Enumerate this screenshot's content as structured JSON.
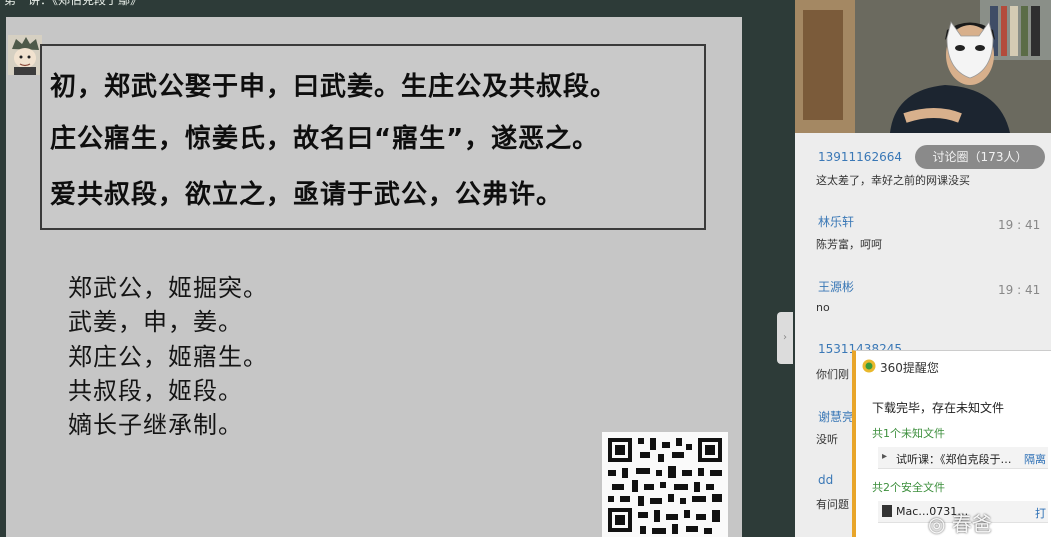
{
  "slide": {
    "title": "第一讲：《郑伯克段于鄢》",
    "quote_lines": [
      "初，郑武公娶于申，曰武姜。生庄公及共叔段。",
      "庄公寤生，惊姜氏，故名曰“寤生”，遂恶之。",
      "爱共叔段，欲立之，亟请于武公，公弗许。"
    ],
    "notes": [
      "郑武公，姬掘突。",
      "武姜，申，姜。",
      "郑庄公，姬寤生。",
      "共叔段，姬段。",
      "嫡长子继承制。"
    ]
  },
  "chat": {
    "discussion_label": "讨论圈（173人）",
    "messages": [
      {
        "name": "13911162664",
        "text": "这太差了，幸好之前的网课没买",
        "time": ""
      },
      {
        "name": "林乐轩",
        "text": "陈芳富，呵呵",
        "time": "19 : 41"
      },
      {
        "name": "王源彬",
        "text": "no",
        "time": "19 : 41"
      },
      {
        "name": "15311438245",
        "text": "你们刚",
        "time": ""
      },
      {
        "name": "谢慧亮",
        "text": "没听",
        "time": ""
      },
      {
        "name": "dd",
        "text": "有问题",
        "time": ""
      }
    ]
  },
  "popup": {
    "title": "360提醒您",
    "message": "下载完毕，存在未知文件",
    "group_unknown": "共1个未知文件",
    "unknown_file": "试听课：《郑伯克段于…",
    "unknown_action": "隔离",
    "group_safe": "共2个安全文件",
    "safe_file": "Mac…0731…",
    "safe_action": "打"
  },
  "watermark": "春爸"
}
